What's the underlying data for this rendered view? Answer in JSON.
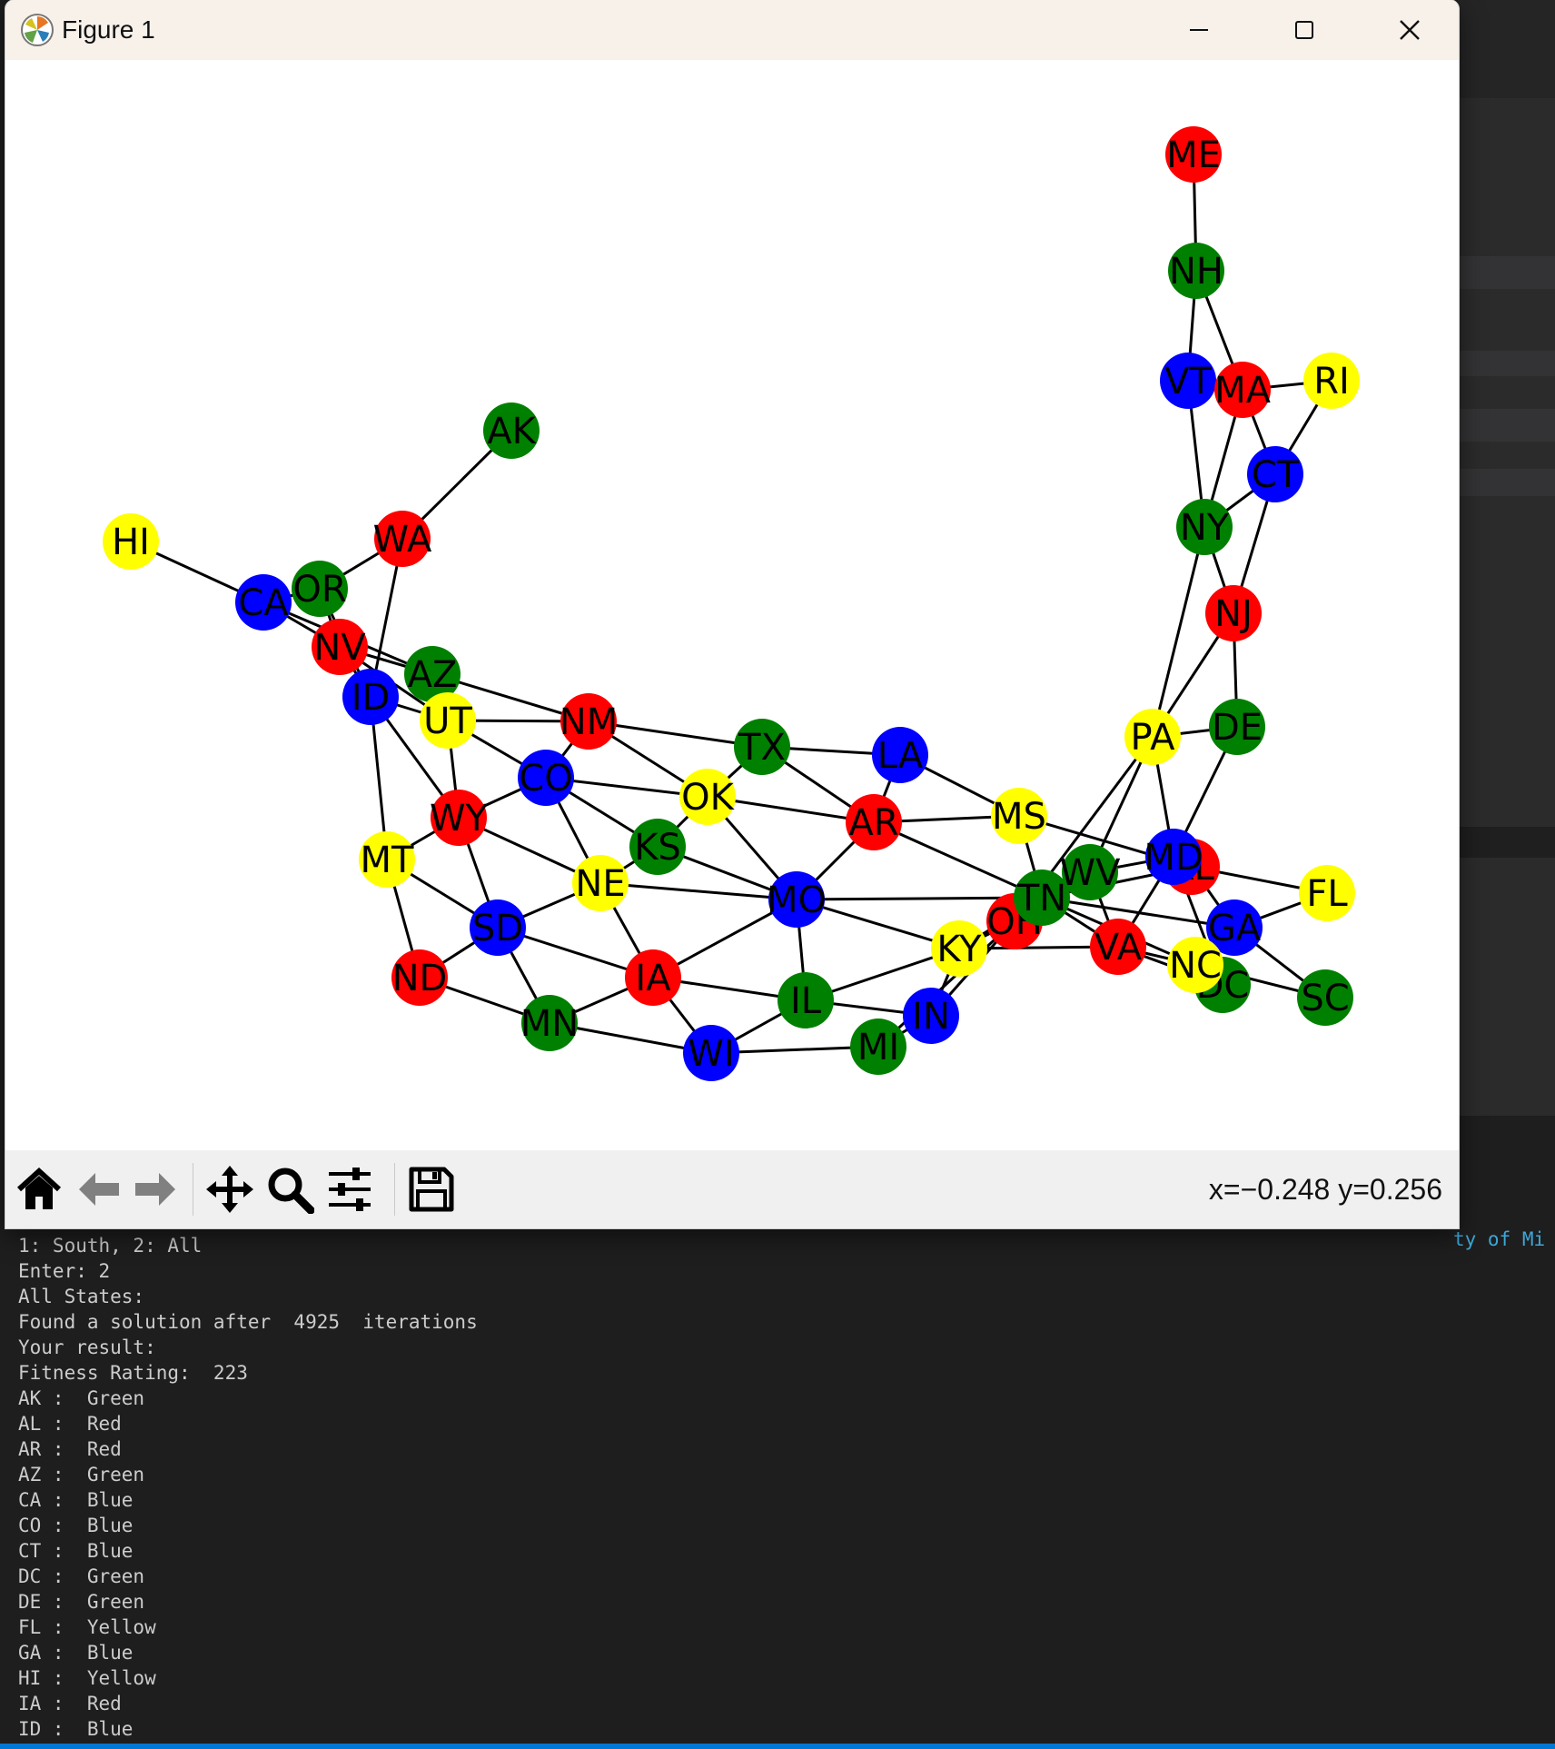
{
  "window": {
    "title": "Figure 1"
  },
  "toolbar": {
    "coordinates": "x=−0.248 y=0.256"
  },
  "colors": {
    "Red": "#ff0000",
    "Green": "#008000",
    "Blue": "#0000ff",
    "Yellow": "#ffff00",
    "edge": "#000000",
    "terminal_bg": "#1e1e1e",
    "terminal_text": "#cccccc",
    "accent": "#0078d4"
  },
  "graph": {
    "nodes": [
      {
        "id": "ME",
        "color": "Red"
      },
      {
        "id": "NH",
        "color": "Green"
      },
      {
        "id": "VT",
        "color": "Blue"
      },
      {
        "id": "MA",
        "color": "Red"
      },
      {
        "id": "RI",
        "color": "Yellow"
      },
      {
        "id": "CT",
        "color": "Blue"
      },
      {
        "id": "NY",
        "color": "Green"
      },
      {
        "id": "NJ",
        "color": "Red"
      },
      {
        "id": "DE",
        "color": "Green"
      },
      {
        "id": "PA",
        "color": "Yellow"
      },
      {
        "id": "AK",
        "color": "Green"
      },
      {
        "id": "HI",
        "color": "Yellow"
      },
      {
        "id": "WA",
        "color": "Red"
      },
      {
        "id": "CA",
        "color": "Blue"
      },
      {
        "id": "OR",
        "color": "Green"
      },
      {
        "id": "NV",
        "color": "Red"
      },
      {
        "id": "AZ",
        "color": "Green"
      },
      {
        "id": "ID",
        "color": "Blue"
      },
      {
        "id": "UT",
        "color": "Yellow"
      },
      {
        "id": "NM",
        "color": "Red"
      },
      {
        "id": "TX",
        "color": "Green"
      },
      {
        "id": "LA",
        "color": "Blue"
      },
      {
        "id": "CO",
        "color": "Blue"
      },
      {
        "id": "OK",
        "color": "Yellow"
      },
      {
        "id": "AR",
        "color": "Red"
      },
      {
        "id": "MS",
        "color": "Yellow"
      },
      {
        "id": "WY",
        "color": "Red"
      },
      {
        "id": "KS",
        "color": "Green"
      },
      {
        "id": "MT",
        "color": "Yellow"
      },
      {
        "id": "NE",
        "color": "Yellow"
      },
      {
        "id": "MO",
        "color": "Blue"
      },
      {
        "id": "SD",
        "color": "Blue"
      },
      {
        "id": "ND",
        "color": "Red"
      },
      {
        "id": "IA",
        "color": "Red"
      },
      {
        "id": "MN",
        "color": "Green"
      },
      {
        "id": "IL",
        "color": "Green"
      },
      {
        "id": "WI",
        "color": "Blue"
      },
      {
        "id": "MI",
        "color": "Green"
      },
      {
        "id": "IN",
        "color": "Blue"
      },
      {
        "id": "KY",
        "color": "Yellow"
      },
      {
        "id": "OH",
        "color": "Red"
      },
      {
        "id": "TN",
        "color": "Green"
      },
      {
        "id": "WV",
        "color": "Green"
      },
      {
        "id": "AL",
        "color": "Red"
      },
      {
        "id": "MD",
        "color": "Blue"
      },
      {
        "id": "VA",
        "color": "Red"
      },
      {
        "id": "GA",
        "color": "Blue"
      },
      {
        "id": "FL",
        "color": "Yellow"
      },
      {
        "id": "DC",
        "color": "Green"
      },
      {
        "id": "NC",
        "color": "Yellow"
      },
      {
        "id": "SC",
        "color": "Green"
      }
    ],
    "edges": [
      [
        "ME",
        "NH"
      ],
      [
        "NH",
        "VT"
      ],
      [
        "NH",
        "MA"
      ],
      [
        "VT",
        "MA"
      ],
      [
        "VT",
        "NY"
      ],
      [
        "MA",
        "RI"
      ],
      [
        "MA",
        "CT"
      ],
      [
        "MA",
        "NY"
      ],
      [
        "RI",
        "CT"
      ],
      [
        "CT",
        "NY"
      ],
      [
        "CT",
        "NJ"
      ],
      [
        "NY",
        "NJ"
      ],
      [
        "NY",
        "PA"
      ],
      [
        "NJ",
        "PA"
      ],
      [
        "NJ",
        "DE"
      ],
      [
        "PA",
        "DE"
      ],
      [
        "PA",
        "MD"
      ],
      [
        "PA",
        "WV"
      ],
      [
        "PA",
        "OH"
      ],
      [
        "DE",
        "MD"
      ],
      [
        "MD",
        "WV"
      ],
      [
        "MD",
        "VA"
      ],
      [
        "MD",
        "DC"
      ],
      [
        "VA",
        "DC"
      ],
      [
        "VA",
        "WV"
      ],
      [
        "VA",
        "NC"
      ],
      [
        "VA",
        "TN"
      ],
      [
        "VA",
        "KY"
      ],
      [
        "NC",
        "TN"
      ],
      [
        "NC",
        "GA"
      ],
      [
        "NC",
        "SC"
      ],
      [
        "GA",
        "SC"
      ],
      [
        "GA",
        "FL"
      ],
      [
        "GA",
        "AL"
      ],
      [
        "GA",
        "TN"
      ],
      [
        "AL",
        "FL"
      ],
      [
        "AL",
        "TN"
      ],
      [
        "AL",
        "MS"
      ],
      [
        "MS",
        "TN"
      ],
      [
        "MS",
        "AR"
      ],
      [
        "MS",
        "LA"
      ],
      [
        "LA",
        "AR"
      ],
      [
        "LA",
        "TX"
      ],
      [
        "TX",
        "AR"
      ],
      [
        "TX",
        "OK"
      ],
      [
        "TX",
        "NM"
      ],
      [
        "AR",
        "OK"
      ],
      [
        "AR",
        "MO"
      ],
      [
        "AR",
        "TN"
      ],
      [
        "OK",
        "NM"
      ],
      [
        "OK",
        "CO"
      ],
      [
        "OK",
        "KS"
      ],
      [
        "OK",
        "MO"
      ],
      [
        "NM",
        "CO"
      ],
      [
        "NM",
        "AZ"
      ],
      [
        "NM",
        "UT"
      ],
      [
        "AZ",
        "CA"
      ],
      [
        "AZ",
        "NV"
      ],
      [
        "AZ",
        "UT"
      ],
      [
        "CA",
        "NV"
      ],
      [
        "CA",
        "OR"
      ],
      [
        "CA",
        "HI"
      ],
      [
        "OR",
        "NV"
      ],
      [
        "OR",
        "WA"
      ],
      [
        "OR",
        "ID"
      ],
      [
        "WA",
        "ID"
      ],
      [
        "WA",
        "AK"
      ],
      [
        "NV",
        "ID"
      ],
      [
        "NV",
        "UT"
      ],
      [
        "ID",
        "UT"
      ],
      [
        "ID",
        "WY"
      ],
      [
        "ID",
        "MT"
      ],
      [
        "UT",
        "WY"
      ],
      [
        "UT",
        "CO"
      ],
      [
        "CO",
        "WY"
      ],
      [
        "CO",
        "NE"
      ],
      [
        "CO",
        "KS"
      ],
      [
        "KS",
        "NE"
      ],
      [
        "KS",
        "MO"
      ],
      [
        "NE",
        "WY"
      ],
      [
        "NE",
        "SD"
      ],
      [
        "NE",
        "IA"
      ],
      [
        "NE",
        "MO"
      ],
      [
        "WY",
        "MT"
      ],
      [
        "WY",
        "SD"
      ],
      [
        "MT",
        "SD"
      ],
      [
        "MT",
        "ND"
      ],
      [
        "SD",
        "ND"
      ],
      [
        "SD",
        "MN"
      ],
      [
        "SD",
        "IA"
      ],
      [
        "ND",
        "MN"
      ],
      [
        "MN",
        "IA"
      ],
      [
        "MN",
        "WI"
      ],
      [
        "IA",
        "WI"
      ],
      [
        "IA",
        "IL"
      ],
      [
        "IA",
        "MO"
      ],
      [
        "MO",
        "IL"
      ],
      [
        "MO",
        "KY"
      ],
      [
        "MO",
        "TN"
      ],
      [
        "IL",
        "WI"
      ],
      [
        "IL",
        "IN"
      ],
      [
        "IL",
        "KY"
      ],
      [
        "WI",
        "MI"
      ],
      [
        "MI",
        "IN"
      ],
      [
        "MI",
        "OH"
      ],
      [
        "IN",
        "OH"
      ],
      [
        "IN",
        "KY"
      ],
      [
        "KY",
        "OH"
      ],
      [
        "KY",
        "WV"
      ],
      [
        "KY",
        "TN"
      ],
      [
        "OH",
        "WV"
      ],
      [
        "WV",
        "TN"
      ]
    ]
  },
  "terminal": {
    "cut_text": "ty of Mi",
    "lines": [
      "1: South, 2: All",
      "Enter: 2",
      "All States:",
      "Found a solution after  4925  iterations",
      "Your result:",
      "Fitness Rating:  223",
      "AK :  Green",
      "AL :  Red",
      "AR :  Red",
      "AZ :  Green",
      "CA :  Blue",
      "CO :  Blue",
      "CT :  Blue",
      "DC :  Green",
      "DE :  Green",
      "FL :  Yellow",
      "GA :  Blue",
      "HI :  Yellow",
      "IA :  Red",
      "ID :  Blue"
    ]
  }
}
